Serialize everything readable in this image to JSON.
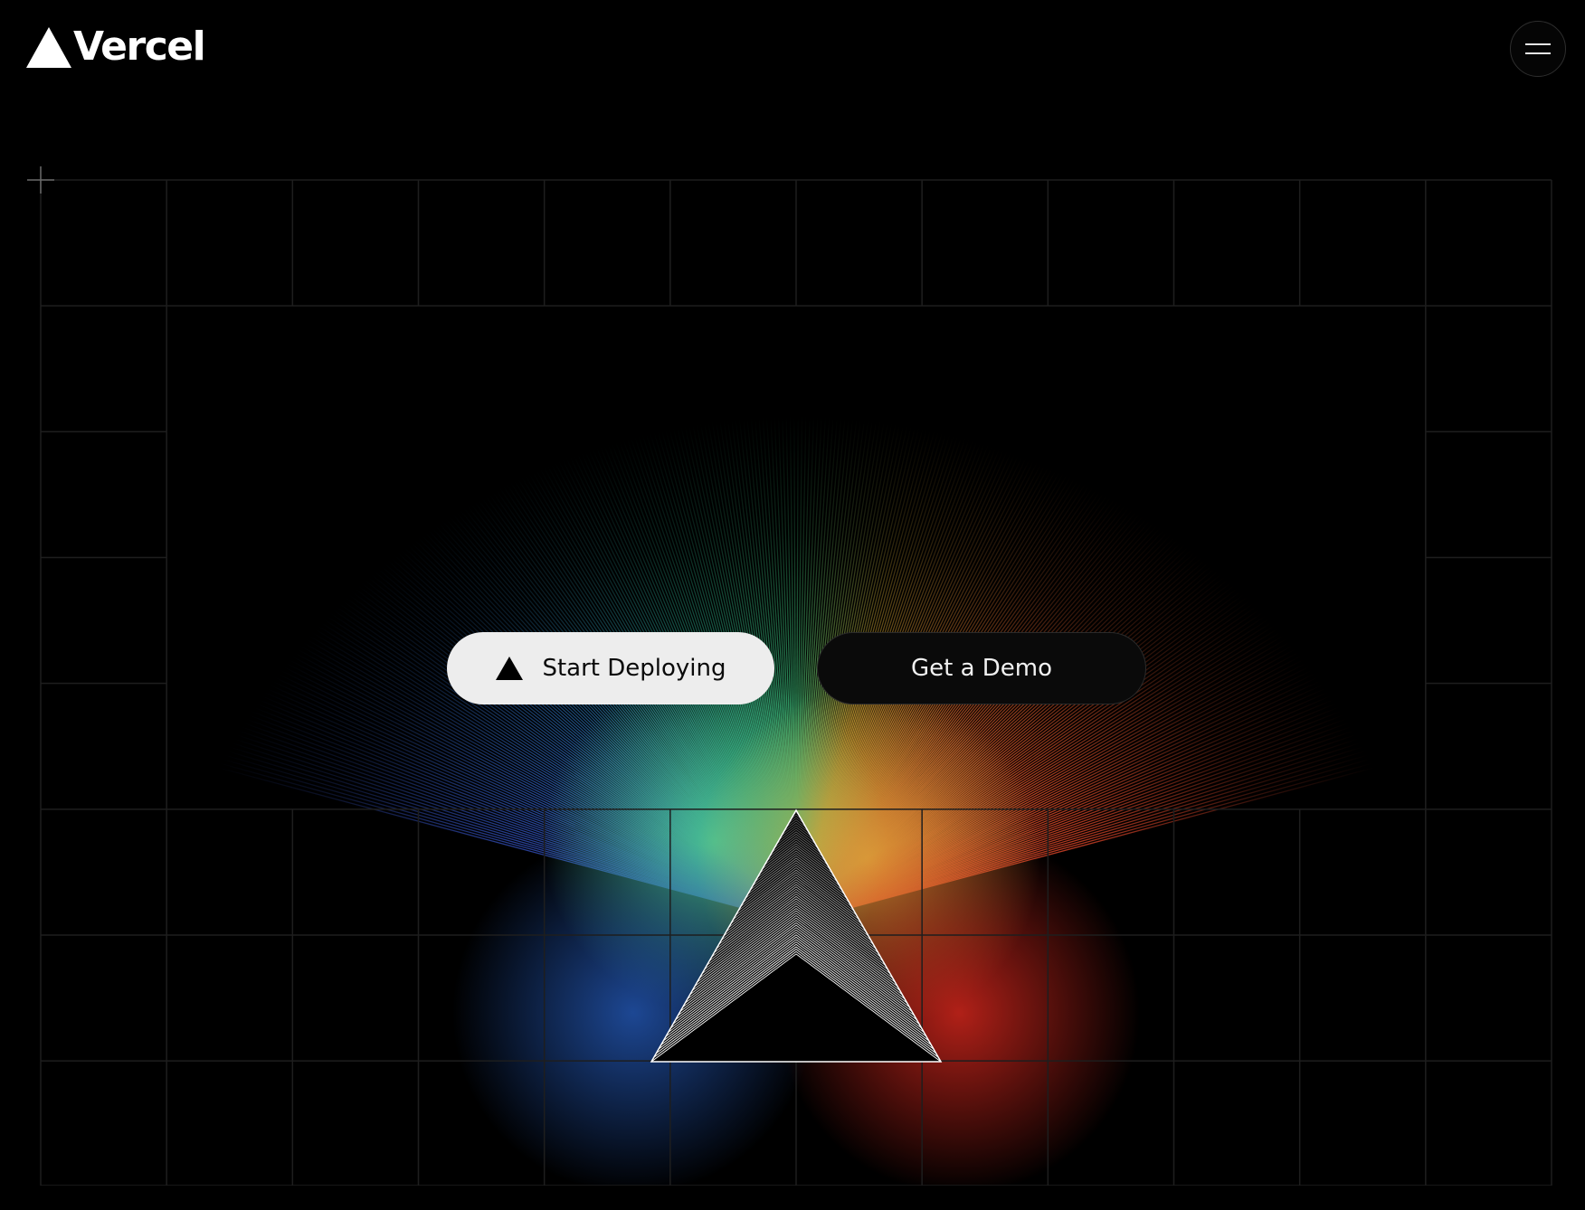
{
  "brand": {
    "name": "Vercel",
    "logo_icon": "vercel-triangle-icon"
  },
  "header": {
    "menu_icon": "hamburger-menu-icon"
  },
  "hero": {
    "primary_cta_label": "Start Deploying",
    "primary_cta_icon": "vercel-triangle-icon",
    "secondary_cta_label": "Get a Demo",
    "prism_icon": "prism-triangle-icon"
  },
  "colors": {
    "background": "#000000",
    "primary_button_bg": "#ededed",
    "primary_button_text": "#0a0a0a",
    "secondary_button_bg": "#0a0a0a",
    "secondary_button_text": "#f2f2f2",
    "grid_line": "#1e1e1e",
    "spectrum": [
      "#2b3fa8",
      "#2f79c4",
      "#2fbf7a",
      "#d9a52b",
      "#e0452a",
      "#e8532f"
    ]
  }
}
